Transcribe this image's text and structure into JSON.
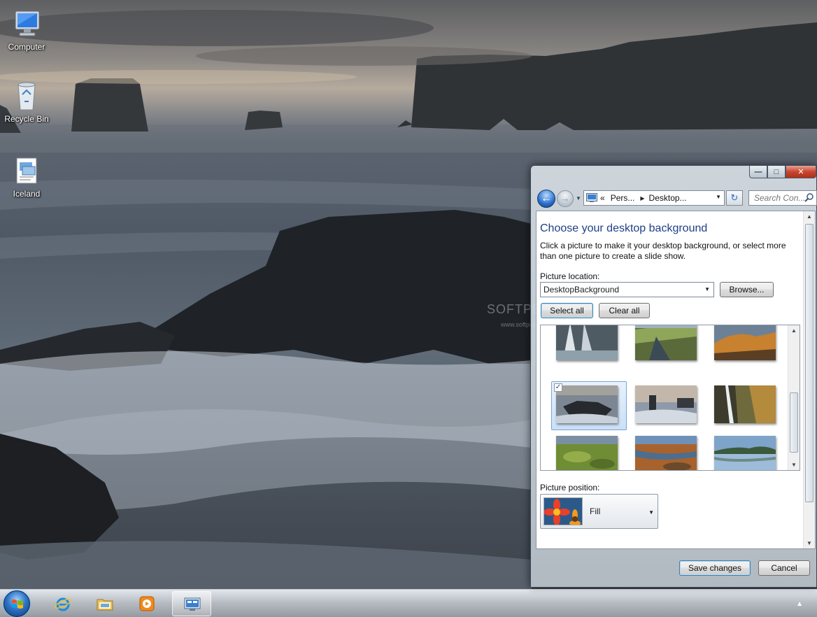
{
  "desktop": {
    "icons": [
      {
        "label": "Computer"
      },
      {
        "label": "Recycle Bin"
      },
      {
        "label": "Iceland"
      }
    ],
    "watermark": "SOFTPEDIA",
    "watermark_url": "www.softpedia.com"
  },
  "window": {
    "caption": {
      "minimize": "—",
      "maximize": "□",
      "close": "✕"
    },
    "nav": {
      "back": "←",
      "forward": "→",
      "breadcrumb_prefix": "«",
      "breadcrumb": [
        "Pers...",
        "Desktop..."
      ],
      "refresh": "↻",
      "search_placeholder": "Search Con..."
    },
    "title": "Choose your desktop background",
    "description": "Click a picture to make it your desktop background, or select more than one picture to create a slide show.",
    "picture_location_label": "Picture location:",
    "picture_location_value": "DesktopBackground",
    "browse_label": "Browse...",
    "select_all_label": "Select all",
    "clear_all_label": "Clear all",
    "thumbnails": [
      {
        "name": "waterfall-1",
        "selected": false
      },
      {
        "name": "green-canyon",
        "selected": false
      },
      {
        "name": "orange-hills",
        "selected": false
      },
      {
        "name": "coast-rocks",
        "selected": true
      },
      {
        "name": "sea-stacks",
        "selected": false
      },
      {
        "name": "tall-waterfall",
        "selected": false
      },
      {
        "name": "mossy-lava",
        "selected": false
      },
      {
        "name": "river-bed",
        "selected": false
      },
      {
        "name": "mountain-lake",
        "selected": false
      }
    ],
    "checkmark": "✓",
    "picture_position_label": "Picture position:",
    "picture_position_value": "Fill",
    "save_label": "Save changes",
    "cancel_label": "Cancel"
  },
  "colors": {
    "title_blue": "#1e3f86",
    "selection": "#c9e0f7"
  }
}
